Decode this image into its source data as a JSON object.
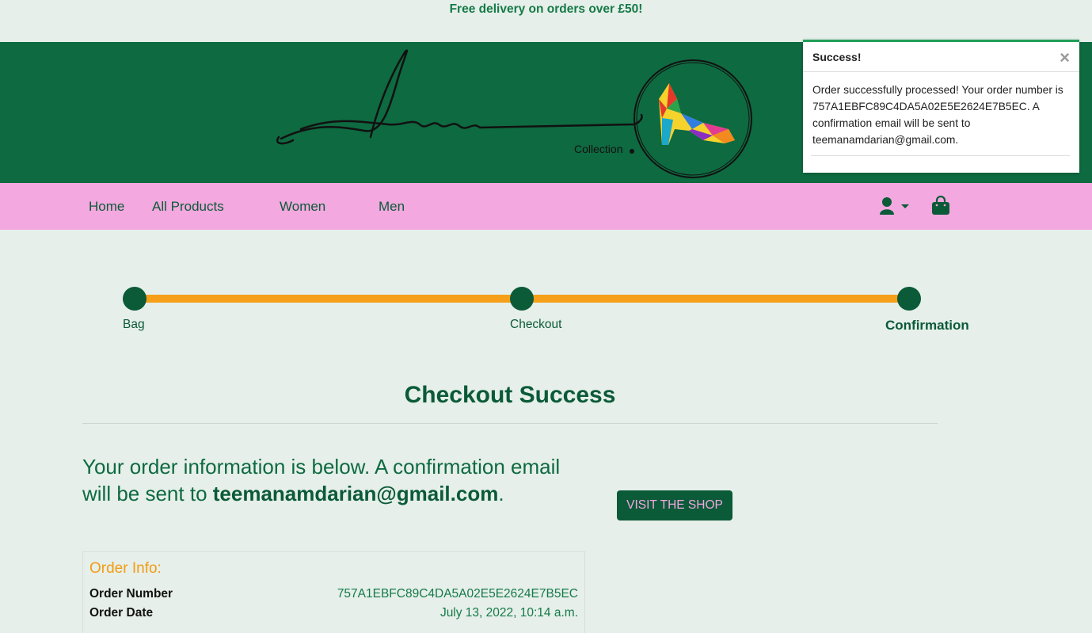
{
  "promo_banner": "Free delivery on orders over £50!",
  "logo": {
    "script_text": "Sarah",
    "subtitle": "Collection"
  },
  "nav": {
    "items": [
      "Home",
      "All Products",
      "Women",
      "Men"
    ],
    "icons": [
      "user-icon",
      "shopping-bag-icon"
    ]
  },
  "toast": {
    "title": "Success!",
    "close": "×",
    "message": "Order successfully processed! Your order number is 757A1EBFC89C4DA5A02E5E2624E7B5EC. A confirmation email will be sent to teemanamdarian@gmail.com."
  },
  "progress": {
    "steps": [
      "Bag",
      "Checkout",
      "Confirmation"
    ],
    "active_step": "Confirmation"
  },
  "page_title": "Checkout Success",
  "intro": {
    "text": "Your order information is below. A confirmation email will be sent to ",
    "email": "teemanamdarian@gmail.com",
    "end": "."
  },
  "shop_button": "VISIT THE SHOP",
  "order_info": {
    "title": "Order Info:",
    "rows": [
      {
        "label": "Order Number",
        "value": "757A1EBFC89C4DA5A02E5E2624E7B5EC"
      },
      {
        "label": "Order Date",
        "value": "July 13, 2022, 10:14 a.m."
      }
    ]
  },
  "colors": {
    "primary_green": "#0b5a38",
    "header_green": "#0e6a40",
    "nav_pink": "#f3a8df",
    "progress_orange": "#f6a01a",
    "background": "#e6efea"
  }
}
